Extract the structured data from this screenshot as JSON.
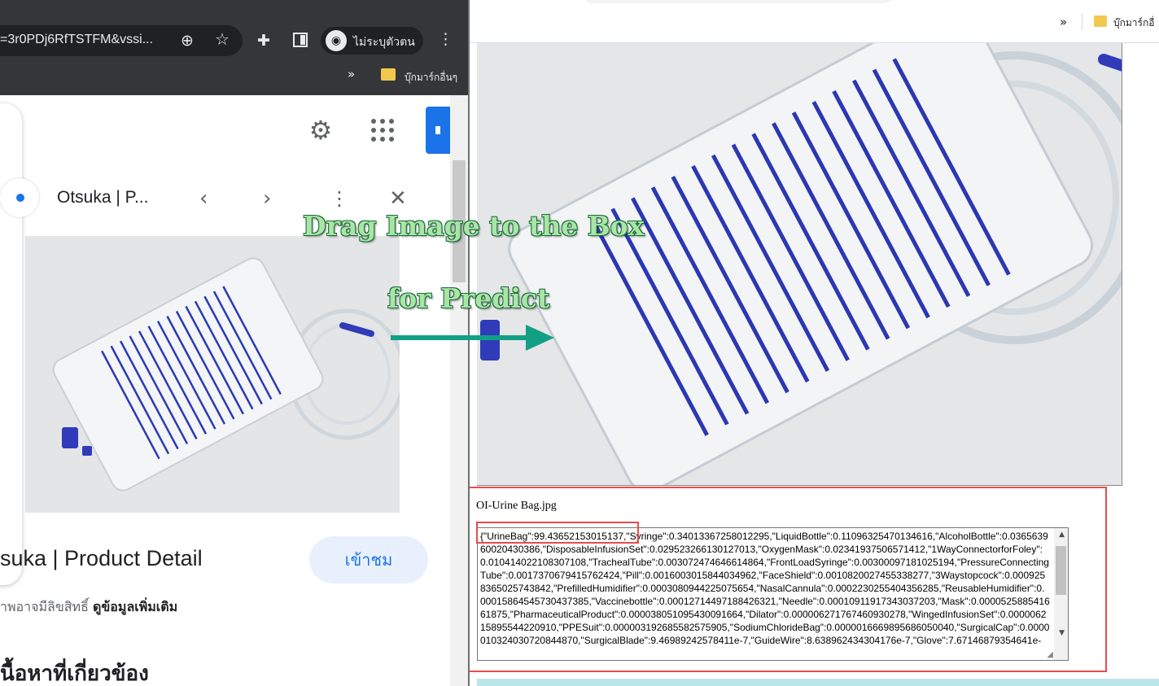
{
  "left_browser": {
    "omnibox_text": "=3r0PDj6RfTSTFM&vssi...",
    "profile_label": "ไม่ระบุตัวตน",
    "bookmarks_more": "»",
    "bookmark_folder": "บุ๊กมาร์กอื่นๆ",
    "icons": [
      "zoom-icon",
      "star-icon",
      "extensions-icon",
      "side-panel-icon",
      "incognito-icon",
      "menu-icon"
    ]
  },
  "image_viewer": {
    "title": "Otsuka | P...",
    "product_caption": "suka | Product Detail",
    "visit_button": "เข้าชม",
    "copyright_text": "าพอาจมีลิขสิทธิ์ ",
    "more_info_link": "ดูข้อมูลเพิ่มเติม",
    "related_heading": "นื้อหาที่เกี่ยวข้อง"
  },
  "right_browser": {
    "bookmarks_more": "»",
    "bookmark_folder": "บุ๊กมาร์กอื่"
  },
  "annotation": {
    "line1": "Drag Image to the Box",
    "line2": "for Predict"
  },
  "result": {
    "file_name": "OI-Urine Bag.jpg",
    "prediction_json": "{\"UrineBag\":99.43652153015137,\"Syringe\":0.34013367258012295,\"LiquidBottle\":0.11096325470134616,\"AlcoholBottle\":0.036563960020430386,\"DisposableInfusionSet\":0.029523266130127013,\"OxygenMask\":0.02341937506571412,\"1WayConnectorforFoley\":0.010414022108307108,\"TrachealTube\":0.003072474646614864,\"FrontLoadSyringe\":0.00300097181025194,\"PressureConnectingTube\":0.0017370679415762424,\"Pill\":0.0016003015844034962,\"FaceShield\":0.0010820027455338277,\"3Waystopcock\":0.0009258365025743842,\"PrefilledHumidifier\":0.0003080944225075654,\"NasalCannula\":0.0002230255404356285,\"ReusableHumidifier\":0.00015864545730437385,\"Vaccinebottle\":0.00012714497188426321,\"Needle\":0.00010911917343037203,\"Mask\":0.000052588541661875,\"PharmaceuticalProduct\":0.000038051095430091664,\"Dilator\":0.000006271767460930278,\"WingedInfusionSet\":0.000006215895544220910,\"PPESuit\":0.000003192685582575905,\"SodiumChlorideBag\":0.0000016669895686050040,\"SurgicalCap\":0.0000010324030720844870,\"SurgicalBlade\":9.46989242578411e-7,\"GuideWire\":8.638962434304176e-7,\"Glove\":7.67146879354641e-"
  },
  "colors": {
    "annotation_text": "#a8e6a6",
    "arrow": "#12a085",
    "highlight_border": "#e74c4c",
    "visit_button_bg": "#e8f0fe",
    "link_blue": "#1a73e8"
  }
}
